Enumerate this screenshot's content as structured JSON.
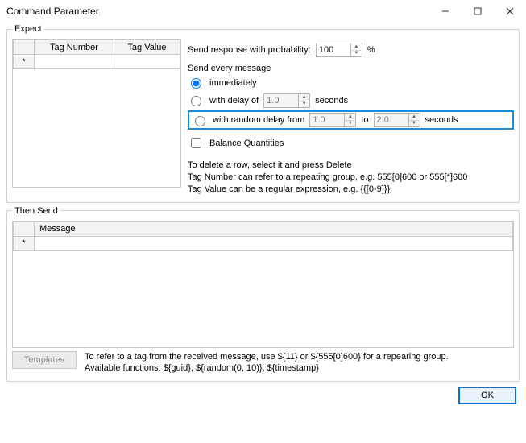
{
  "window": {
    "title": "Command Parameter"
  },
  "expect": {
    "legend": "Expect",
    "cols": {
      "tagNumber": "Tag Number",
      "tagValue": "Tag Value"
    },
    "rowMarker": "*",
    "probability": {
      "label": "Send response with probability:",
      "value": "100",
      "unit": "%"
    },
    "sendEvery": {
      "heading": "Send every message",
      "immediately": "immediately",
      "withDelay": {
        "label": "with delay of",
        "value": "1.0",
        "unit": "seconds"
      },
      "withRandom": {
        "label": "with random delay from",
        "from": "1.0",
        "toLabel": "to",
        "to": "2.0",
        "unit": "seconds"
      }
    },
    "balance": "Balance Quantities",
    "help1": "To delete a row, select it and press Delete",
    "help2": "Tag Number can refer to a repeating group, e.g. 555[0]600 or 555[*]600",
    "help3": "Tag Value can be a regular expression, e.g. {{[0-9]}}"
  },
  "thenSend": {
    "legend": "Then Send",
    "col": "Message",
    "rowMarker": "*",
    "templatesBtn": "Templates",
    "help1": "To refer to a tag from the received message, use ${11} or ${555[0]600} for a repearing group.",
    "help2": "Available functions: ${guid}, ${random(0, 10)}, ${timestamp}"
  },
  "ok": "OK"
}
